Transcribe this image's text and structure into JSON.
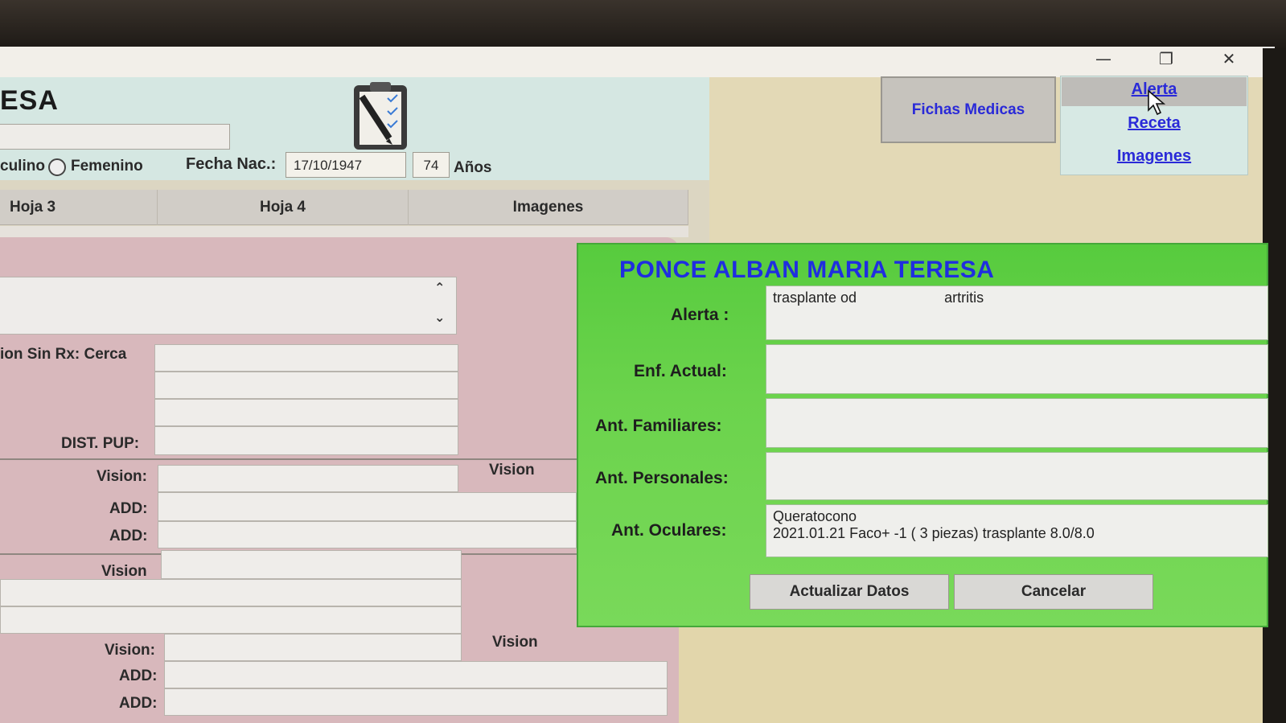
{
  "window": {
    "title_fragment": "ESA",
    "controls": {
      "minimize": "—",
      "restore": "❐",
      "close": "✕"
    }
  },
  "patient_header": {
    "sex_label": "culino",
    "female_label": "Femenino",
    "fecha_label": "Fecha Nac.:",
    "fecha_value": "17/10/1947",
    "age_value": "74",
    "age_unit": "Años"
  },
  "top_buttons": {
    "fichas": "Fichas Medicas",
    "menu": [
      "Alerta",
      "Receta",
      "Imagenes"
    ]
  },
  "tabs": [
    "Hoja 3",
    "Hoja 4",
    "Imagenes"
  ],
  "form": {
    "sin_rx_label": "ion  Sin Rx: Cerca",
    "dist_pup_label": "DIST. PUP:",
    "vision_label_1": "Vision:",
    "vision_header_1": "Vision",
    "add_label_1": "ADD:",
    "add_label_2": "ADD:",
    "vision_label_2": "Vision",
    "vision_label_3": "Vision:",
    "vision_header_2": "Vision",
    "add_label_3": "ADD:",
    "add_label_4": "ADD:"
  },
  "dialog": {
    "patient_name": "PONCE ALBAN MARIA TERESA",
    "alerta_label": "Alerta :",
    "alerta_value_1": "trasplante od",
    "alerta_value_2": "artritis",
    "enf_label": "Enf. Actual:",
    "fam_label": "Ant. Familiares:",
    "pers_label": "Ant. Personales:",
    "ocular_label": "Ant. Oculares:",
    "ocular_line_1": "Queratocono",
    "ocular_line_2": "2021.01.21 Faco+ -1 ( 3 piezas) trasplante  8.0/8.0",
    "update_button": "Actualizar Datos",
    "cancel_button": "Cancelar"
  }
}
